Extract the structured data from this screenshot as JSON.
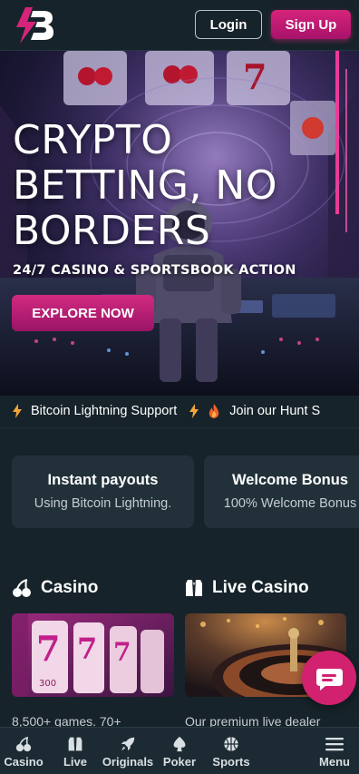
{
  "header": {
    "login_label": "Login",
    "signup_label": "Sign Up",
    "brand_color": "#d6247b"
  },
  "hero": {
    "title_line1": "CRYPTO",
    "title_line2": "BETTING, NO",
    "title_line3": "BORDERS",
    "subtitle": "24/7 CASINO & SPORTSBOOK ACTION",
    "cta_label": "EXPLORE NOW"
  },
  "ticker": {
    "items": [
      {
        "icon": "lightning-icon",
        "text": "Bitcoin Lightning Support"
      },
      {
        "icon": "fire-icon",
        "text": "Join our Hunt S"
      }
    ]
  },
  "promos": [
    {
      "title": "Instant payouts",
      "text": "Using Bitcoin Lightning."
    },
    {
      "title": "Welcome Bonus",
      "text": "100% Welcome Bonus"
    }
  ],
  "sections": {
    "casino": {
      "title": "Casino",
      "icon": "cherries-icon",
      "description": "8,500+ games. 70+"
    },
    "live": {
      "title": "Live Casino",
      "icon": "dealer-suit-icon",
      "description": "Our premium live dealer"
    }
  },
  "bottom_nav": {
    "items": [
      {
        "label": "Casino",
        "icon": "cherries-icon"
      },
      {
        "label": "Live",
        "icon": "dealer-suit-icon"
      },
      {
        "label": "Originals",
        "icon": "rocket-icon"
      },
      {
        "label": "Poker",
        "icon": "spade-icon"
      },
      {
        "label": "Sports",
        "icon": "basketball-icon"
      },
      {
        "label": "Menu",
        "icon": "hamburger-icon"
      }
    ]
  },
  "chat": {
    "icon": "chat-icon"
  }
}
